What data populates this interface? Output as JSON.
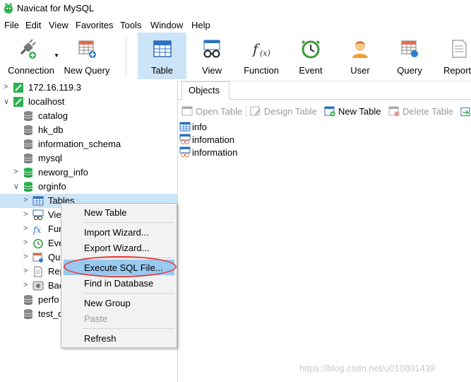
{
  "window": {
    "title": "Navicat for MySQL"
  },
  "menu": [
    "File",
    "Edit",
    "View",
    "Favorites",
    "Tools",
    "Window",
    "Help"
  ],
  "toolbar": {
    "items": [
      {
        "label": "Connection",
        "icon": "plug-icon"
      },
      {
        "label": "New Query",
        "icon": "new-query-icon"
      },
      {
        "label": "Table",
        "icon": "table-icon",
        "active": true
      },
      {
        "label": "View",
        "icon": "view-glasses-icon"
      },
      {
        "label": "Function",
        "icon": "function-fx-icon"
      },
      {
        "label": "Event",
        "icon": "clock-icon"
      },
      {
        "label": "User",
        "icon": "user-icon"
      },
      {
        "label": "Query",
        "icon": "query-icon"
      },
      {
        "label": "Report",
        "icon": "report-icon"
      }
    ]
  },
  "tree": [
    {
      "label": "172.16.119.3",
      "icon": "connection-icon"
    },
    {
      "label": "localhost",
      "icon": "connection-icon"
    },
    {
      "label": "catalog",
      "icon": "database-icon"
    },
    {
      "label": "hk_db",
      "icon": "database-icon"
    },
    {
      "label": "information_schema",
      "icon": "database-icon"
    },
    {
      "label": "mysql",
      "icon": "database-icon"
    },
    {
      "label": "neworg_info",
      "icon": "database-open-icon"
    },
    {
      "label": "orginfo",
      "icon": "database-open-icon"
    },
    {
      "label": "Tables",
      "icon": "table-icon"
    },
    {
      "label": "Vie",
      "icon": "view-icon"
    },
    {
      "label": "Fun",
      "icon": "function-icon"
    },
    {
      "label": "Eve",
      "icon": "event-icon"
    },
    {
      "label": "Qu",
      "icon": "query-icon"
    },
    {
      "label": "Rep",
      "icon": "report-icon"
    },
    {
      "label": "Bac",
      "icon": "backup-icon"
    },
    {
      "label": "perfo",
      "icon": "database-icon"
    },
    {
      "label": "test_d",
      "icon": "database-icon"
    }
  ],
  "tabs": {
    "objects": "Objects"
  },
  "object_toolbar": {
    "open_table": "Open Table",
    "design_table": "Design Table",
    "new_table": "New Table",
    "delete_table": "Delete Table"
  },
  "objects": [
    "info",
    "infomation",
    "information"
  ],
  "context_menu": {
    "new_table": "New Table",
    "import_wizard": "Import Wizard...",
    "export_wizard": "Export Wizard...",
    "execute_sql_file": "Execute SQL File...",
    "find_in_database": "Find in Database",
    "new_group": "New Group",
    "paste": "Paste",
    "refresh": "Refresh"
  },
  "watermark": "https://blog.csdn.net/u010801439",
  "colors": {
    "accent": "#cce4f7",
    "highlight": "#99c9ef",
    "annotation": "#e23d3d",
    "db_green": "#2bb24c"
  }
}
